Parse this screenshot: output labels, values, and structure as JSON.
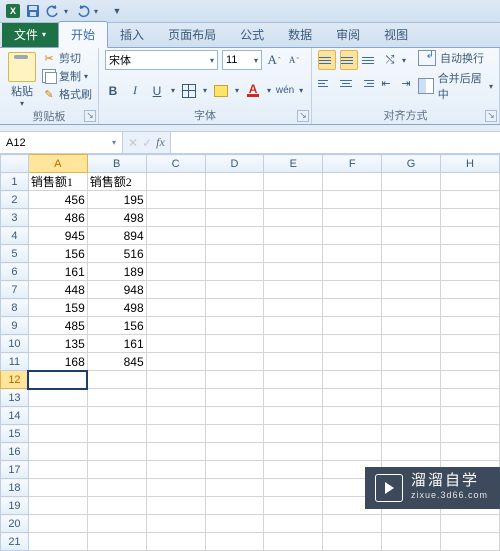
{
  "qat": {
    "save": "保存",
    "undo": "撤销",
    "redo": "恢复"
  },
  "tabs": {
    "file": "文件",
    "items": [
      "开始",
      "插入",
      "页面布局",
      "公式",
      "数据",
      "审阅",
      "视图"
    ],
    "active_index": 0
  },
  "ribbon": {
    "clipboard": {
      "paste": "粘贴",
      "cut": "剪切",
      "copy": "复制",
      "format_painter": "格式刷",
      "group_label": "剪贴板"
    },
    "font": {
      "name": "宋体",
      "size": "11",
      "grow": "A",
      "shrink": "A",
      "bold": "B",
      "italic": "I",
      "underline": "U",
      "group_label": "字体"
    },
    "align": {
      "wrap": "自动换行",
      "merge": "合并后居中",
      "group_label": "对齐方式"
    }
  },
  "namebox": "A12",
  "formula": "",
  "columns": [
    "A",
    "B",
    "C",
    "D",
    "E",
    "F",
    "G",
    "H"
  ],
  "selected_col": "A",
  "selected_row": 12,
  "headers": {
    "A": "销售额1",
    "B": "销售额2"
  },
  "rows": [
    {
      "A": 456,
      "B": 195
    },
    {
      "A": 486,
      "B": 498
    },
    {
      "A": 945,
      "B": 894
    },
    {
      "A": 156,
      "B": 516
    },
    {
      "A": 161,
      "B": 189
    },
    {
      "A": 448,
      "B": 948
    },
    {
      "A": 159,
      "B": 498
    },
    {
      "A": 485,
      "B": 156
    },
    {
      "A": 135,
      "B": 161
    },
    {
      "A": 168,
      "B": 845
    }
  ],
  "total_rows_shown": 21,
  "chart_data": {
    "type": "table",
    "title": "",
    "columns": [
      "销售额1",
      "销售额2"
    ],
    "data": [
      [
        456,
        195
      ],
      [
        486,
        498
      ],
      [
        945,
        894
      ],
      [
        156,
        516
      ],
      [
        161,
        189
      ],
      [
        448,
        948
      ],
      [
        159,
        498
      ],
      [
        485,
        156
      ],
      [
        135,
        161
      ],
      [
        168,
        845
      ]
    ]
  },
  "watermark": {
    "cn": "溜溜自学",
    "en": "zixue.3d66.com"
  }
}
